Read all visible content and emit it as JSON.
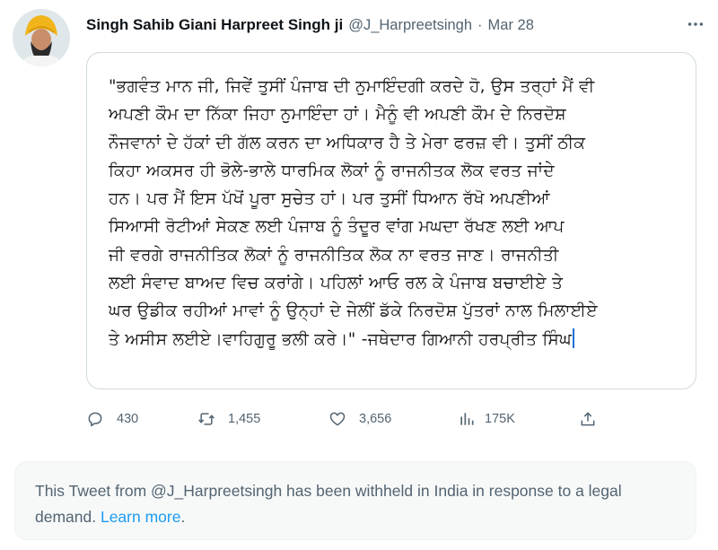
{
  "tweet": {
    "author_name": "Singh Sahib Giani Harpreet Singh ji",
    "handle": "@J_Harpreetsingh",
    "separator": "·",
    "date": "Mar 28",
    "image_text": "\"ਭਗਵੰਤ ਮਾਨ ਜੀ, ਜਿਵੇਂ ਤੁਸੀਂ ਪੰਜਾਬ ਦੀ ਨੁਮਾਇੰਦਗੀ ਕਰਦੇ ਹੋ, ਉਸ ਤਰ੍ਹਾਂ ਮੈਂ ਵੀ\nਅਪਣੀ ਕੌਮ ਦਾ ਨਿੱਕਾ ਜਿਹਾ ਨੁਮਾਇੰਦਾ ਹਾਂ। ਮੈਨੂੰ ਵੀ ਅਪਣੀ ਕੌਮ ਦੇ ਨਿਰਦੋਸ਼\nਨੌਜਵਾਨਾਂ ਦੇ ਹੱਕਾਂ ਦੀ ਗੱਲ ਕਰਨ ਦਾ ਅਧਿਕਾਰ ਹੈ ਤੇ ਮੇਰਾ ਫਰਜ਼ ਵੀ। ਤੁਸੀਂ ਠੀਕ\nਕਿਹਾ ਅਕਸਰ ਹੀ ਭੋਲੇ-ਭਾਲੇ ਧਾਰਮਿਕ ਲੋਕਾਂ ਨੂੰ ਰਾਜਨੀਤਕ ਲੋਕ ਵਰਤ ਜਾਂਦੇ\nਹਨ। ਪਰ ਮੈਂ ਇਸ ਪੱਖੋਂ ਪੂਰਾ ਸੁਚੇਤ ਹਾਂ। ਪਰ ਤੁਸੀਂ ਧਿਆਨ ਰੱਖੋ ਅਪਣੀਆਂ\nਸਿਆਸੀ ਰੋਟੀਆਂ ਸੇਕਣ ਲਈ ਪੰਜਾਬ ਨੂੰ ਤੰਦੂਰ ਵਾਂਗ ਮਘਦਾ ਰੱਖਣ ਲਈ ਆਪ\nਜੀ ਵਰਗੇ ਰਾਜਨੀਤਿਕ ਲੋਕਾਂ ਨੂੰ ਰਾਜਨੀਤਿਕ ਲੋਕ ਨਾ ਵਰਤ ਜਾਣ। ਰਾਜਨੀਤੀ\nਲਈ ਸੰਵਾਦ ਬਾਅਦ ਵਿਚ ਕਰਾਂਗੇ। ਪਹਿਲਾਂ ਆਓ ਰਲ ਕੇ ਪੰਜਾਬ ਬਚਾਈਏ ਤੇ\nਘਰ ਉਡੀਕ ਰਹੀਆਂ ਮਾਵਾਂ ਨੂੰ ਉਨ੍ਹਾਂ ਦੇ ਜੇਲੀਂ ਡੱਕੇ ਨਿਰਦੋਸ਼ ਪੁੱਤਰਾਂ ਨਾਲ ਮਿਲਾਈਏ\nਤੇ ਅਸੀਸ ਲਈਏ।ਵਾਹਿਗੁਰੂ ਭਲੀ ਕਰੇ।\"   -ਜਥੇਦਾਰ ਗਿਆਨੀ ਹਰਪ੍ਰੀਤ ਸਿੰਘ"
  },
  "actions": {
    "reply_count": "430",
    "retweet_count": "1,455",
    "like_count": "3,656",
    "views_count": "175K"
  },
  "notice": {
    "text": "This Tweet from @J_Harpreetsingh has been withheld in India in response to a legal demand. ",
    "link": "Learn more",
    "end": "."
  },
  "colors": {
    "text_primary": "#0f1419",
    "text_secondary": "#536471",
    "link": "#1d9bf0",
    "border": "#cfd9de",
    "notice_bg": "#f7f9f9"
  },
  "icons": [
    "avatar",
    "more-icon",
    "reply-icon",
    "retweet-icon",
    "like-icon",
    "views-icon",
    "share-icon"
  ]
}
